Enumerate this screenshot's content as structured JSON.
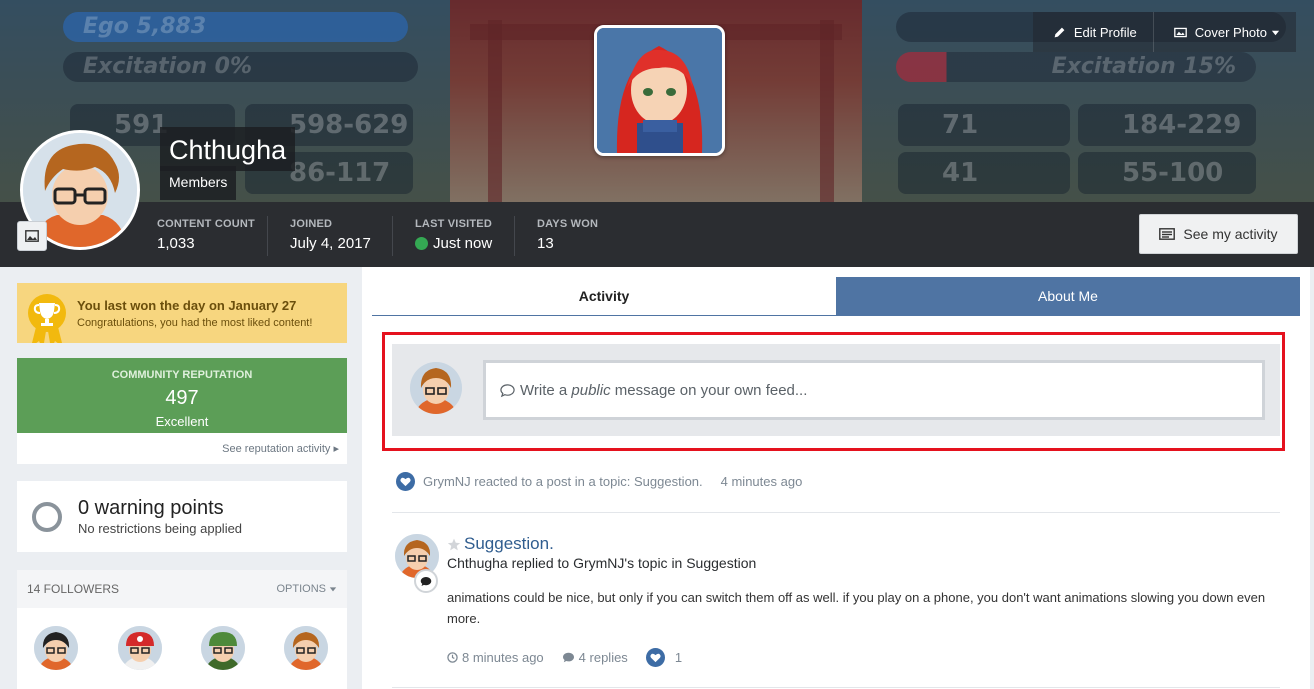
{
  "cover": {
    "game_stats_left": {
      "ego": "Ego 5,883",
      "excitation": "Excitation 0%",
      "s1": "591",
      "s2": "598-629",
      "s3": "86-117"
    },
    "game_stats_right": {
      "excitation": "Excitation 15%",
      "s1": "71",
      "s2": "184-229",
      "s3": "41",
      "s4": "55-100"
    },
    "edit_profile_label": "Edit Profile",
    "cover_photo_label": "Cover Photo"
  },
  "profile": {
    "name": "Chthugha",
    "group": "Members"
  },
  "stats": [
    {
      "label": "CONTENT COUNT",
      "value": "1,033"
    },
    {
      "label": "JOINED",
      "value": "July 4, 2017"
    },
    {
      "label": "LAST VISITED",
      "value": "Just now"
    },
    {
      "label": "DAYS WON",
      "value": "13"
    }
  ],
  "see_activity_label": "See my activity",
  "day_won": {
    "title": "You last won the day on January 27",
    "subtitle": "Congratulations, you had the most liked content!"
  },
  "reputation": {
    "label": "COMMUNITY REPUTATION",
    "value": "497",
    "word": "Excellent",
    "link": "See reputation activity"
  },
  "warnings": {
    "title": "0 warning points",
    "subtitle": "No restrictions being applied"
  },
  "followers": {
    "title": "14 FOLLOWERS",
    "options": "OPTIONS"
  },
  "tabs": [
    {
      "label": "Activity"
    },
    {
      "label": "About Me"
    }
  ],
  "composer": {
    "prefix": "Write a ",
    "emph": "public",
    "suffix": " message on your own feed..."
  },
  "feed": {
    "reaction_text": "GrymNJ reacted to a post in a topic: Suggestion.",
    "reaction_time": "4 minutes ago",
    "post": {
      "title": "Suggestion.",
      "subtitle": "Chthugha replied to GrymNJ's topic in Suggestion",
      "body": "animations could be nice, but only if you can switch them off as well. if you play on a phone, you don't want animations slowing you down even more.",
      "time": "8 minutes ago",
      "replies": "4 replies",
      "reactions": "1"
    }
  },
  "colors": {
    "accent_blue": "#4f74a3",
    "reputation_green": "#5c9e57",
    "highlight_red": "#e5121e",
    "gold": "#f7d67f"
  }
}
